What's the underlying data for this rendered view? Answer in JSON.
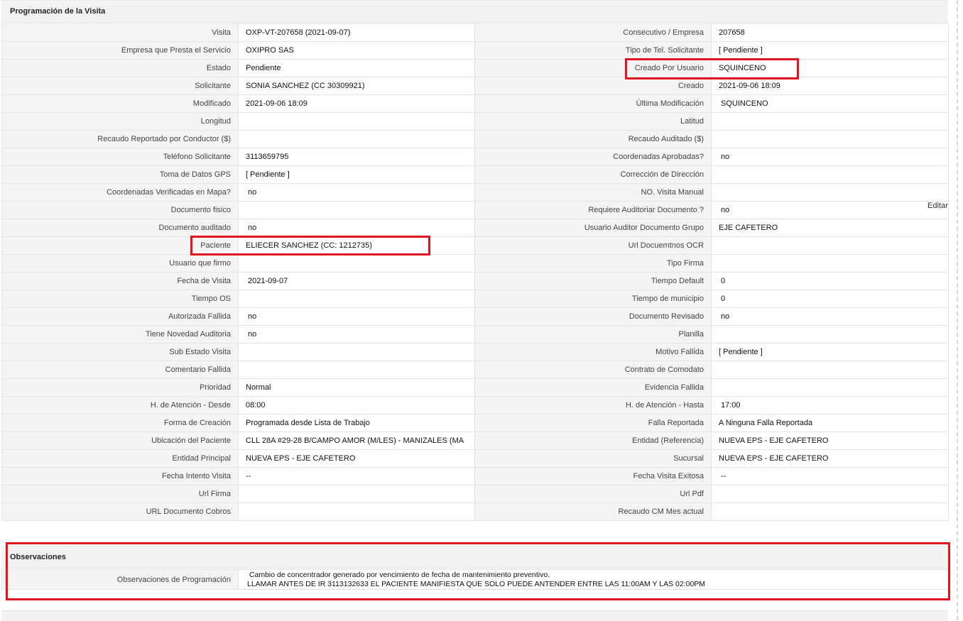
{
  "section_title": "Programación de la Visita",
  "edit_label": "Editar",
  "rows": [
    {
      "l1": "Visita",
      "v1": "OXP-VT-207658 (2021-09-07)",
      "l2": "Consecutivo / Empresa",
      "v2": "207658"
    },
    {
      "l1": "Empresa que Presta el Servicio",
      "v1": "OXIPRO SAS",
      "l2": "Tipo de Tel. Solicitante",
      "v2": "[ Pendiente ]"
    },
    {
      "l1": "Estado",
      "v1": "Pendiente",
      "l2": "Creado Por Usuario",
      "v2": "SQUINCENO"
    },
    {
      "l1": "Solicitante",
      "v1": "SONIA SANCHEZ (CC 30309921)",
      "l2": "Creado",
      "v2": "2021-09-06 18:09"
    },
    {
      "l1": "Modificado",
      "v1": "2021-09-06 18:09",
      "l2": "Última Modificación",
      "v2": "SQUINCENO"
    },
    {
      "l1": "Longitud",
      "v1": "",
      "l2": "Latitud",
      "v2": ""
    },
    {
      "l1": "Recaudo Reportado por Conductor ($)",
      "v1": "",
      "l2": "Recaudo Auditado ($)",
      "v2": ""
    },
    {
      "l1": "Teléfono Solicitante",
      "v1": "3113659795",
      "l2": "Coordenadas Aprobadas?",
      "v2": "no"
    },
    {
      "l1": "Toma de Datos GPS",
      "v1": "[ Pendiente ]",
      "l2": "Corrección de Dirección",
      "v2": ""
    },
    {
      "l1": "Coordenadas Verificadas en Mapa?",
      "v1": "no",
      "l2": "NO. Visita Manual",
      "v2": ""
    },
    {
      "l1": "Documento fisico",
      "v1": "",
      "l2": "Requiere Auditoriar Documento ?",
      "v2": "no"
    },
    {
      "l1": "Documento auditado",
      "v1": "no",
      "l2": "Usuario Auditor Documento Grupo",
      "v2": "EJE CAFETERO"
    },
    {
      "l1": "Paciente",
      "v1": "ELIECER SANCHEZ (CC: 1212735)",
      "l2": "Url Docuemtnos OCR",
      "v2": ""
    },
    {
      "l1": "Usuario que firmo",
      "v1": "",
      "l2": "Tipo Firma",
      "v2": ""
    },
    {
      "l1": "Fecha de Visita",
      "v1": "2021-09-07",
      "l2": "Tiempo Default",
      "v2": "0"
    },
    {
      "l1": "Tiempo OS",
      "v1": "",
      "l2": "Tiempo de municipio",
      "v2": "0"
    },
    {
      "l1": "Autorizada Fallida",
      "v1": "no",
      "l2": "Documento Revisado",
      "v2": "no"
    },
    {
      "l1": "Tiene Novedad Auditoria",
      "v1": "no",
      "l2": "Planilla",
      "v2": ""
    },
    {
      "l1": "Sub Estado Visita",
      "v1": "",
      "l2": "Motivo Fallida",
      "v2": "[ Pendiente ]"
    },
    {
      "l1": "Comentario Fallida",
      "v1": "",
      "l2": "Contrato de Comodato",
      "v2": ""
    },
    {
      "l1": "Prioridad",
      "v1": "Normal",
      "l2": "Evidencia Fallida",
      "v2": ""
    },
    {
      "l1": "H. de Atención - Desde",
      "v1": "08:00",
      "l2": "H. de Atención - Hasta",
      "v2": "17:00"
    },
    {
      "l1": "Forma de Creación",
      "v1": "Programada desde Lista de Trabajo",
      "l2": "Falla Reportada",
      "v2": "A Ninguna Falla Reportada"
    },
    {
      "l1": "Ubicación del Paciente",
      "v1": "CLL 28A #29-28 B/CAMPO AMOR (M/LES) - MANIZALES (MA",
      "l2": "Entidad (Referencia)",
      "v2": "NUEVA EPS - EJE CAFETERO"
    },
    {
      "l1": "Entidad Principal",
      "v1": "NUEVA EPS - EJE CAFETERO",
      "l2": "Sucursal",
      "v2": "NUEVA EPS - EJE CAFETERO"
    },
    {
      "l1": "Fecha Intento Visita",
      "v1": "--",
      "l2": "Fecha Visita Exitosa",
      "v2": "--"
    },
    {
      "l1": "Url Firma",
      "v1": "",
      "l2": "Url Pdf",
      "v2": ""
    },
    {
      "l1": "URL Documento Cobros",
      "v1": "",
      "l2": "Recaudo CM Mes actual",
      "v2": ""
    }
  ],
  "observations": {
    "title": "Observaciones",
    "label": "Observaciones de Programación",
    "line1": " Cambio de concentrador generado por vencimiento de fecha de mantenimiento preventivo.",
    "line2": "LLAMAR ANTES DE IR 3113132633 EL PACIENTE MANIFIESTA QUE SOLO PUEDE ANTENDER ENTRE LAS 11:00AM Y LAS 02:00PM"
  },
  "colors": {
    "highlight": "#e1141f",
    "label_bg": "#f4f4f4",
    "header_bg": "#f3f3f3"
  }
}
